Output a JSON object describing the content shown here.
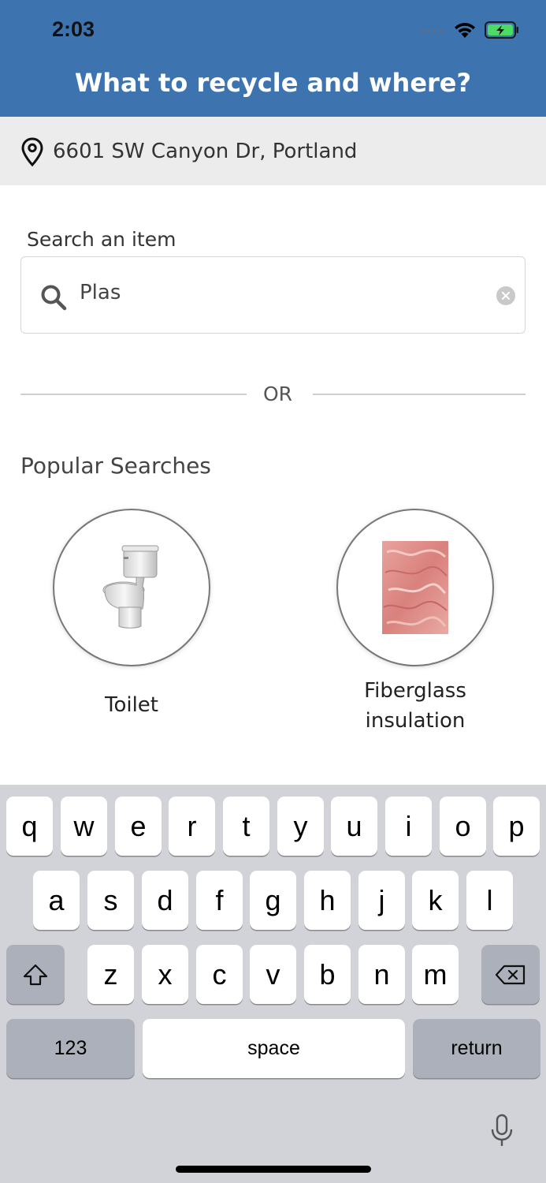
{
  "status_bar": {
    "time": "2:03"
  },
  "header": {
    "title": "What to recycle and where?"
  },
  "location": {
    "address": "6601 SW Canyon Dr, Portland"
  },
  "search": {
    "label": "Search an item",
    "value": "Plas"
  },
  "divider": {
    "text": "OR"
  },
  "popular": {
    "title": "Popular Searches",
    "items": [
      {
        "label": "Toilet",
        "icon": "toilet-icon"
      },
      {
        "label": "Fiberglass insulation",
        "icon": "fiberglass-insulation-image"
      }
    ]
  },
  "keyboard": {
    "row1": [
      "q",
      "w",
      "e",
      "r",
      "t",
      "y",
      "u",
      "i",
      "o",
      "p"
    ],
    "row2": [
      "a",
      "s",
      "d",
      "f",
      "g",
      "h",
      "j",
      "k",
      "l"
    ],
    "row3": [
      "z",
      "x",
      "c",
      "v",
      "b",
      "n",
      "m"
    ],
    "numbers_label": "123",
    "space_label": "space",
    "return_label": "return"
  },
  "colors": {
    "header": "#3d74b0",
    "location_bar": "#ececec",
    "keyboard_bg": "#d1d3d9"
  }
}
